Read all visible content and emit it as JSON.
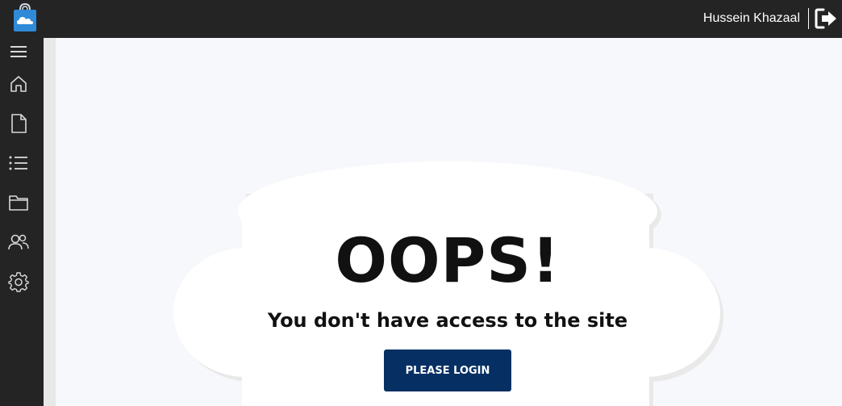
{
  "header": {
    "user_name": "Hussein Khazaal",
    "logo_icon": "shopping-bag-cloud-icon",
    "logout_icon": "logout-icon"
  },
  "sidebar": {
    "items": [
      {
        "icon": "menu-icon"
      },
      {
        "icon": "home-icon"
      },
      {
        "icon": "document-icon"
      },
      {
        "icon": "list-icon"
      },
      {
        "icon": "folder-icon"
      },
      {
        "icon": "users-icon"
      },
      {
        "icon": "settings-icon"
      }
    ]
  },
  "error": {
    "title": "OOPS!",
    "message": "You don't have access to the site",
    "login_label": "PLEASE LOGIN"
  },
  "colors": {
    "topbar_bg": "#242424",
    "page_bg": "#f7f8fc",
    "button_bg": "#063063",
    "logo_blue": "#2f8ad8"
  }
}
